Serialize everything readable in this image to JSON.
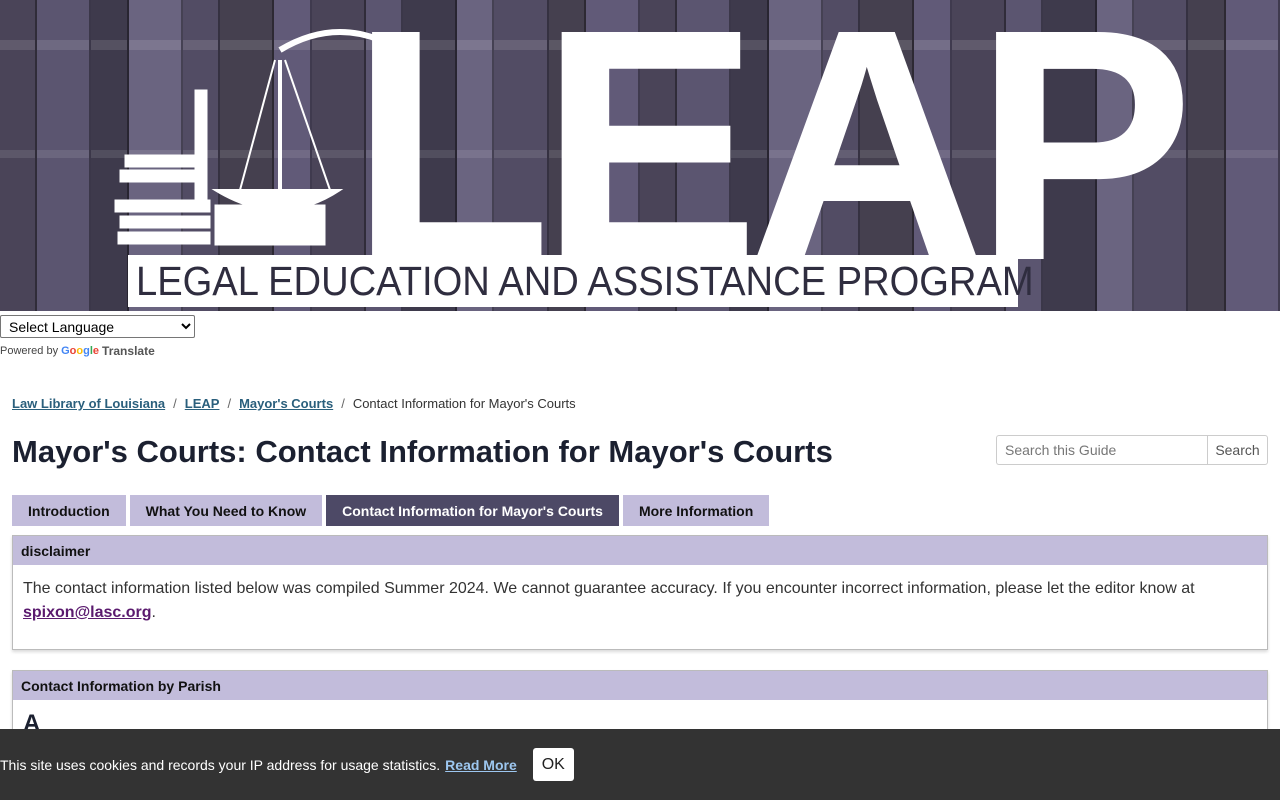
{
  "banner": {
    "logo_letters": "LEAP",
    "logo_subtitle": "LEGAL EDUCATION AND ASSISTANCE PROGRAM"
  },
  "translate": {
    "select_value": "Select Language",
    "powered_by": "Powered by",
    "google": "Google",
    "translate_label": "Translate"
  },
  "breadcrumb": {
    "items": [
      "Law Library of Louisiana",
      "LEAP",
      "Mayor's Courts"
    ],
    "current": "Contact Information for Mayor's Courts"
  },
  "page_title": "Mayor's Courts: Contact Information for Mayor's Courts",
  "search": {
    "placeholder": "Search this Guide",
    "button_label": "Search"
  },
  "tabs": [
    {
      "label": "Introduction",
      "active": false
    },
    {
      "label": "What You Need to Know",
      "active": false
    },
    {
      "label": "Contact Information for Mayor's Courts",
      "active": true
    },
    {
      "label": "More Information",
      "active": false
    }
  ],
  "disclaimer": {
    "heading": "disclaimer",
    "text": "The contact information listed below was compiled Summer 2024. We cannot guarantee accuracy. If you encounter incorrect information, please let the editor know at",
    "email": "spixon@lasc.org",
    "trailing": "."
  },
  "parish_box": {
    "heading": "Contact Information by Parish",
    "first_letter": "A"
  },
  "cookie": {
    "text": "This site uses cookies and records your IP address for usage statistics.",
    "link": "Read More",
    "ok": "OK"
  },
  "colors": {
    "tab_bg": "#c2bcdb",
    "tab_active_bg": "#4d4966",
    "link": "#2a5f7c",
    "cookie_bg": "#333333"
  }
}
